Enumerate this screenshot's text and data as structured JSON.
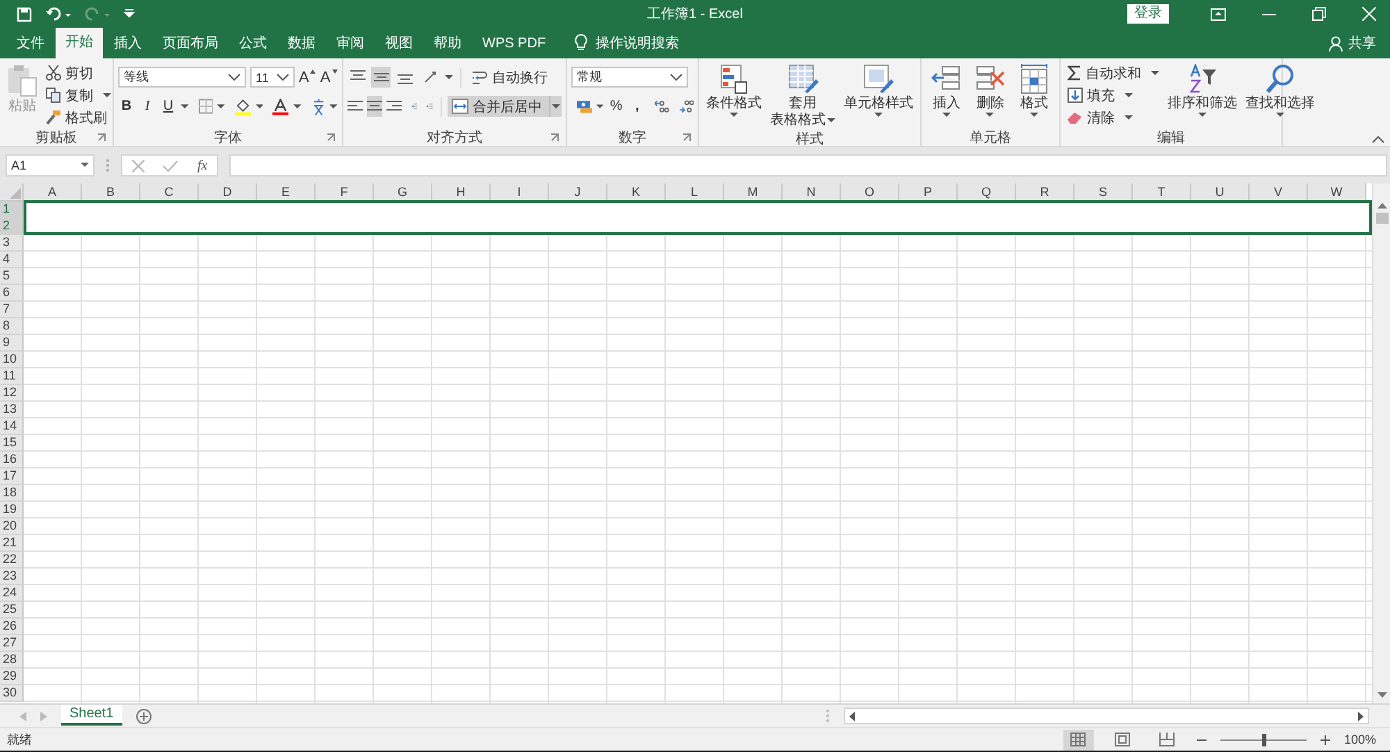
{
  "title_bar": {
    "title": "工作簿1 - Excel",
    "sign_in": "登录"
  },
  "tabs": [
    {
      "label": "文件",
      "selected": false
    },
    {
      "label": "开始",
      "selected": true
    },
    {
      "label": "插入",
      "selected": false
    },
    {
      "label": "页面布局",
      "selected": false
    },
    {
      "label": "公式",
      "selected": false
    },
    {
      "label": "数据",
      "selected": false
    },
    {
      "label": "审阅",
      "selected": false
    },
    {
      "label": "视图",
      "selected": false
    },
    {
      "label": "帮助",
      "selected": false
    },
    {
      "label": "WPS PDF",
      "selected": false
    }
  ],
  "tell_me": "操作说明搜索",
  "share": "共享",
  "ribbon": {
    "clipboard": {
      "label": "剪贴板",
      "paste": "粘贴",
      "paste_disabled": true,
      "cut": "剪切",
      "copy": "复制",
      "format_painter": "格式刷"
    },
    "font": {
      "label": "字体",
      "font_name": "等线",
      "font_size": "11",
      "grow": "A",
      "shrink": "A",
      "bold": "B",
      "italic": "I",
      "underline": "U"
    },
    "alignment": {
      "label": "对齐方式",
      "vertical": [
        {
          "selected": false
        },
        {
          "selected": true
        },
        {
          "selected": false
        }
      ],
      "horizontal": [
        {
          "selected": false
        },
        {
          "selected": true
        },
        {
          "selected": false
        }
      ],
      "wrap": "自动换行",
      "merge": "合并后居中",
      "merge_selected": true
    },
    "number": {
      "label": "数字",
      "format": "常规",
      "percent": "%",
      "comma": ","
    },
    "styles": {
      "label": "样式",
      "conditional": "条件格式",
      "table_line1": "套用",
      "table_line2": "表格格式",
      "cell_styles": "单元格样式"
    },
    "cells": {
      "label": "单元格",
      "insert": "插入",
      "delete": "删除",
      "format": "格式"
    },
    "editing": {
      "label": "编辑",
      "autosum": "自动求和",
      "fill": "填充",
      "clear": "清除",
      "sort": "排序和筛选",
      "find": "查找和选择"
    }
  },
  "name_box": "A1",
  "fx": "fx",
  "columns": [
    "A",
    "B",
    "C",
    "D",
    "E",
    "F",
    "G",
    "H",
    "I",
    "J",
    "K",
    "L",
    "M",
    "N",
    "O",
    "P",
    "Q",
    "R",
    "S",
    "T",
    "U",
    "V",
    "W"
  ],
  "rows": [
    {
      "label": "1",
      "selected": true
    },
    {
      "label": "2",
      "selected": true
    },
    {
      "label": "3",
      "selected": false
    },
    {
      "label": "4",
      "selected": false
    },
    {
      "label": "5",
      "selected": false
    },
    {
      "label": "6",
      "selected": false
    },
    {
      "label": "7",
      "selected": false
    },
    {
      "label": "8",
      "selected": false
    },
    {
      "label": "9",
      "selected": false
    },
    {
      "label": "10",
      "selected": false
    },
    {
      "label": "11",
      "selected": false
    },
    {
      "label": "12",
      "selected": false
    },
    {
      "label": "13",
      "selected": false
    },
    {
      "label": "14",
      "selected": false
    },
    {
      "label": "15",
      "selected": false
    },
    {
      "label": "16",
      "selected": false
    },
    {
      "label": "17",
      "selected": false
    },
    {
      "label": "18",
      "selected": false
    },
    {
      "label": "19",
      "selected": false
    },
    {
      "label": "20",
      "selected": false
    },
    {
      "label": "21",
      "selected": false
    },
    {
      "label": "22",
      "selected": false
    },
    {
      "label": "23",
      "selected": false
    },
    {
      "label": "24",
      "selected": false
    },
    {
      "label": "25",
      "selected": false
    },
    {
      "label": "26",
      "selected": false
    },
    {
      "label": "27",
      "selected": false
    },
    {
      "label": "28",
      "selected": false
    },
    {
      "label": "29",
      "selected": false
    },
    {
      "label": "30",
      "selected": false
    }
  ],
  "sheet_tabs": [
    {
      "label": "Sheet1",
      "selected": true
    }
  ],
  "status": "就绪",
  "views": [
    {
      "selected": true
    },
    {
      "selected": false
    },
    {
      "selected": false
    }
  ],
  "zoom": {
    "level": 0.5,
    "reading": "100%"
  }
}
